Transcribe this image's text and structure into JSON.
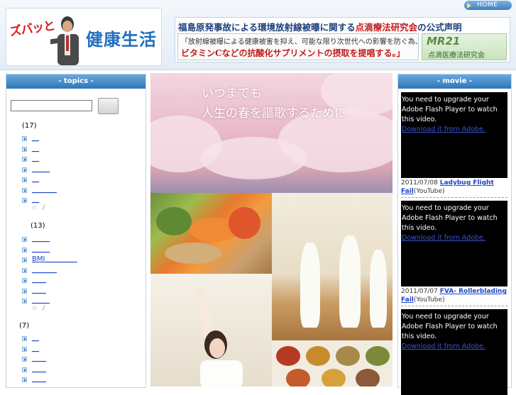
{
  "header": {
    "home_label": "HOME",
    "logo": {
      "left_text": "ズバッと",
      "right_text": "健康生活"
    },
    "banner": {
      "line1_a": "福島原発事故による環境放射線被曝に関する",
      "line1_b": "点滴療法研究会",
      "line1_c": "の公式声明",
      "line2": "「放射線被曝による健康被害を抑え、可能な限り次世代への影響を防ぐ為、",
      "line3": "ビタミンCなどの抗酸化サプリメントの摂取を提唱する。」",
      "mr_big": "MR21",
      "mr_small": "点滴医療法研究会"
    }
  },
  "topics": {
    "title": "- topics -",
    "search_placeholder": "",
    "groups": [
      {
        "count": "(17)",
        "items": [
          "__",
          "__",
          "__",
          "_____",
          "__",
          "_______",
          "__"
        ],
        "more": "/"
      },
      {
        "count": "(13)",
        "items": [
          "_____",
          "_____",
          "BMI_________",
          "_______",
          "____",
          "____",
          "_____"
        ],
        "more": "/"
      },
      {
        "count": "(7)",
        "items": [
          "__",
          "__",
          "____",
          "____",
          "____"
        ]
      }
    ]
  },
  "center": {
    "hero_line1": "いつまでも",
    "hero_line2": "人生の春を謳歌するために"
  },
  "movie": {
    "title": "- movie -",
    "items": [
      {
        "msg": "You need to upgrade your Adobe Flash Player to watch this video.",
        "link": "Download it from Adobe.",
        "date": "2011/07/08",
        "title": "Ladybug Flight Fail",
        "source": "(YouTube)"
      },
      {
        "msg": "You need to upgrade your Adobe Flash Player to watch this video.",
        "link": "Download it from Adobe.",
        "date": "2011/07/07",
        "title": "FVA- Rollerblading Fail",
        "source": "(YouTube)"
      },
      {
        "msg": "You need to upgrade your Adobe Flash Player to watch this video.",
        "link": "Download it from Adobe."
      }
    ]
  },
  "colors": {
    "accent": "#2f76b8",
    "link": "#1a44c9",
    "banner_red": "#c41a1a"
  }
}
